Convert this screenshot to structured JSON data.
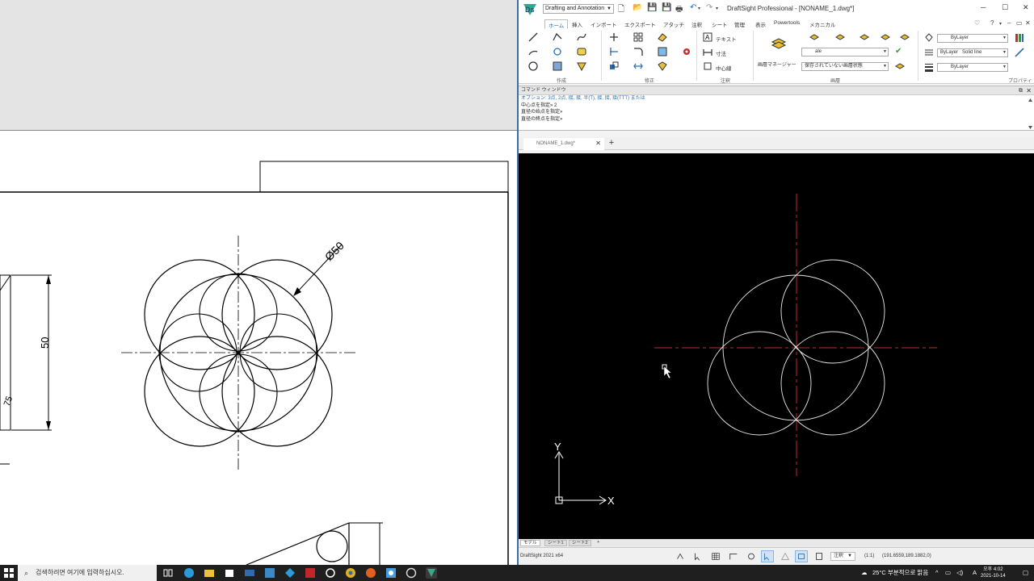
{
  "app": {
    "title": "DraftSight Professional - [NONAME_1.dwg*]",
    "workspace": "Drafting and Annotation",
    "edition": "DraftSight 2021 x64"
  },
  "ribbon_tabs": [
    "ホーム",
    "挿入",
    "インポート",
    "エクスポート",
    "アタッチ",
    "注釈",
    "シート",
    "管理",
    "表示",
    "Powertools",
    "メカニカル"
  ],
  "ribbon_groups": [
    "作成",
    "修正",
    "注釈",
    "画層",
    "プロパティ"
  ],
  "ribbon_controls": {
    "text_label": "テキスト",
    "dimension_label": "寸法",
    "centerline_label": "中心線",
    "layer_manager": "画層マネージャー",
    "layer_name": "ale",
    "layer_state": "保存されていない画層状態",
    "color": "ByLayer",
    "linestyle_layer": "ByLayer",
    "linestyle": "Solid line",
    "lineweight": "ByLayer"
  },
  "command_window": {
    "title": "コマンド ウィンドウ",
    "lines": [
      "オプション: 3点, 2点, 接, 接, 半(T), 接, 接, 接(TTT) または",
      "中心点を指定» 2",
      "直径の始点を指定»",
      "直径の終点を指定»"
    ]
  },
  "document_tab": "NONAME_1.dwg*",
  "layout_tabs": [
    "モデル",
    "シート1",
    "シート2",
    "+"
  ],
  "status": {
    "annotation": "注釈",
    "scale": "(1:1)",
    "coordinates": "(191.6559,189.1882,0)"
  },
  "left_drawing": {
    "dim_diameter": "Ø50",
    "dim_height": "50",
    "dim_partial": "75"
  },
  "axis": {
    "x": "X",
    "y": "Y"
  },
  "taskbar": {
    "search_placeholder": "검색하려면 여기에 입력하십시오.",
    "weather": "25°C 부분적으로 맑음",
    "ime": "A",
    "time": "오후 4:02",
    "date": "2021-10-14"
  },
  "colors": {
    "viewport_bg": "#000000",
    "geometry": "#ffffff",
    "centerline": "#c0272d",
    "accent": "#2a6db5"
  }
}
